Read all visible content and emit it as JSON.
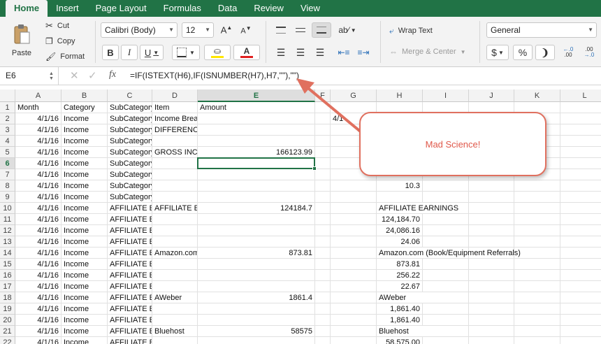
{
  "tabs": [
    "Home",
    "Insert",
    "Page Layout",
    "Formulas",
    "Data",
    "Review",
    "View"
  ],
  "clipboard": {
    "paste": "Paste",
    "cut": "Cut",
    "copy": "Copy",
    "format": "Format"
  },
  "font": {
    "name": "Calibri (Body)",
    "size": "12",
    "bold": "B",
    "italic": "I",
    "underline": "U",
    "color_bar": "#e02020",
    "highlight_bar": "#ffe600"
  },
  "alignment": {
    "wrap_text": "Wrap Text",
    "merge_center": "Merge & Center"
  },
  "number": {
    "format": "General",
    "currency": "$",
    "percent": "%",
    "comma": "❩"
  },
  "formula_bar": {
    "name_box": "E6",
    "fx": "fx",
    "formula": "=IF(ISTEXT(H6),IF(ISNUMBER(H7),H7,\"\"),\"\")"
  },
  "columns": [
    "A",
    "B",
    "C",
    "D",
    "E",
    "F",
    "G",
    "H",
    "I",
    "J",
    "K",
    "L"
  ],
  "rows": [
    {
      "n": "1",
      "A": "Month",
      "B": "Category",
      "C": "SubCategory",
      "D": "Item",
      "E": "Amount",
      "G": "",
      "H": ""
    },
    {
      "n": "2",
      "A": "4/1/16",
      "B": "Income",
      "C": "SubCategory",
      "D": "Income Brea",
      "E": "",
      "G": "4/1",
      "H": ""
    },
    {
      "n": "3",
      "A": "4/1/16",
      "B": "Income",
      "C": "SubCategory",
      "D": "DIFFERENCE",
      "E": "",
      "G": "",
      "H": ""
    },
    {
      "n": "4",
      "A": "4/1/16",
      "B": "Income",
      "C": "SubCategory",
      "D": "",
      "E": "",
      "G": "",
      "H": ""
    },
    {
      "n": "5",
      "A": "4/1/16",
      "B": "Income",
      "C": "SubCategory",
      "D": "GROSS INCO",
      "E": "166123.99",
      "G": "",
      "H": ""
    },
    {
      "n": "6",
      "A": "4/1/16",
      "B": "Income",
      "C": "SubCategory",
      "D": "",
      "E": "",
      "G": "",
      "H": ""
    },
    {
      "n": "7",
      "A": "4/1/16",
      "B": "Income",
      "C": "SubCategory",
      "D": "",
      "E": "",
      "G": "",
      "H": ""
    },
    {
      "n": "8",
      "A": "4/1/16",
      "B": "Income",
      "C": "SubCategory",
      "D": "",
      "E": "",
      "G": "",
      "H": "10.3"
    },
    {
      "n": "9",
      "A": "4/1/16",
      "B": "Income",
      "C": "SubCategory",
      "D": "",
      "E": "",
      "G": "",
      "H": ""
    },
    {
      "n": "10",
      "A": "4/1/16",
      "B": "Income",
      "C": "AFFILIATE EA",
      "D": "AFFILIATE EA",
      "E": "124184.7",
      "G": "",
      "H": "AFFILIATE EARNINGS"
    },
    {
      "n": "11",
      "A": "4/1/16",
      "B": "Income",
      "C": "AFFILIATE EA",
      "D": "",
      "E": "",
      "G": "",
      "H": "124,184.70"
    },
    {
      "n": "12",
      "A": "4/1/16",
      "B": "Income",
      "C": "AFFILIATE EA",
      "D": "",
      "E": "",
      "G": "",
      "H": "24,086.16"
    },
    {
      "n": "13",
      "A": "4/1/16",
      "B": "Income",
      "C": "AFFILIATE EA",
      "D": "",
      "E": "",
      "G": "",
      "H": "24.06"
    },
    {
      "n": "14",
      "A": "4/1/16",
      "B": "Income",
      "C": "AFFILIATE EA",
      "D": "Amazon.com",
      "E": "873.81",
      "G": "",
      "H": "Amazon.com (Book/Equipment Referrals)"
    },
    {
      "n": "15",
      "A": "4/1/16",
      "B": "Income",
      "C": "AFFILIATE EA",
      "D": "",
      "E": "",
      "G": "",
      "H": "873.81"
    },
    {
      "n": "16",
      "A": "4/1/16",
      "B": "Income",
      "C": "AFFILIATE EA",
      "D": "",
      "E": "",
      "G": "",
      "H": "256.22"
    },
    {
      "n": "17",
      "A": "4/1/16",
      "B": "Income",
      "C": "AFFILIATE EA",
      "D": "",
      "E": "",
      "G": "",
      "H": "22.67"
    },
    {
      "n": "18",
      "A": "4/1/16",
      "B": "Income",
      "C": "AFFILIATE EA",
      "D": "AWeber",
      "E": "1861.4",
      "G": "",
      "H": "AWeber"
    },
    {
      "n": "19",
      "A": "4/1/16",
      "B": "Income",
      "C": "AFFILIATE EA",
      "D": "",
      "E": "",
      "G": "",
      "H": "1,861.40"
    },
    {
      "n": "20",
      "A": "4/1/16",
      "B": "Income",
      "C": "AFFILIATE EA",
      "D": "",
      "E": "",
      "G": "",
      "H": "1,861.40"
    },
    {
      "n": "21",
      "A": "4/1/16",
      "B": "Income",
      "C": "AFFILIATE EA",
      "D": "Bluehost",
      "E": "58575",
      "G": "",
      "H": "Bluehost"
    },
    {
      "n": "22",
      "A": "4/1/16",
      "B": "Income",
      "C": "AFFILIATE EA",
      "D": "",
      "E": "",
      "G": "",
      "H": "58,575.00"
    }
  ],
  "annotation": {
    "text": "Mad Science!",
    "color": "#e0584a"
  },
  "theme": {
    "accent": "#217346"
  }
}
